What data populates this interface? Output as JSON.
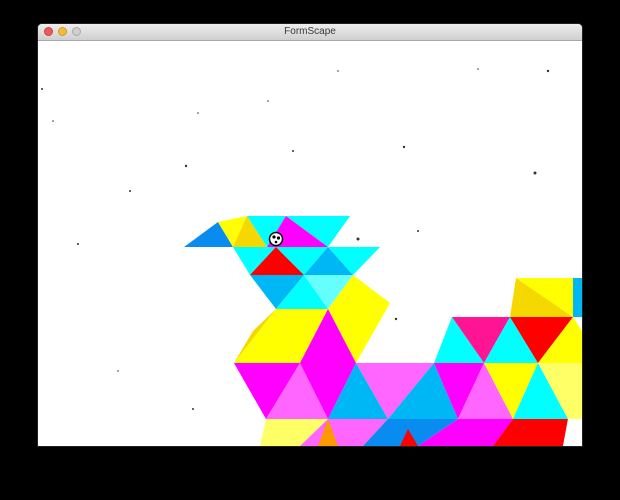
{
  "window": {
    "title": "FormScape",
    "controls": {
      "close": "close-icon",
      "minimize": "minimize-icon",
      "zoom": "zoom-icon"
    }
  },
  "scene": {
    "background": "#ffffff",
    "palette": {
      "yellow": "#ffff00",
      "pale_yellow": "#ffff66",
      "dark_yellow": "#f5d800",
      "cyan": "#00ffff",
      "light_cyan": "#66ffff",
      "sky_blue": "#00b7f5",
      "blue": "#0a8bf0",
      "magenta": "#ff00ff",
      "pink": "#ff66ff",
      "hot_pink": "#ff1493",
      "red": "#ff0000",
      "orange": "#ff9900"
    },
    "player": "ball-character"
  }
}
